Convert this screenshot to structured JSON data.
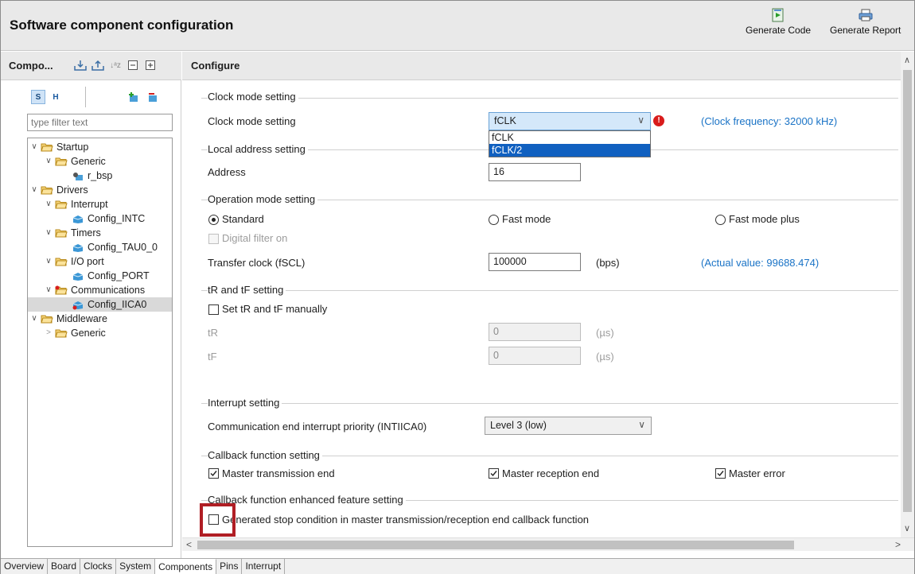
{
  "header": {
    "title": "Software component configuration",
    "generate_code": "Generate Code",
    "generate_report": "Generate Report"
  },
  "left": {
    "title": "Compo...",
    "filter_placeholder": "type filter text",
    "tree": [
      {
        "label": "Startup",
        "type": "folder",
        "expanded": true
      },
      {
        "label": "Generic",
        "type": "folder",
        "expanded": true
      },
      {
        "label": "r_bsp",
        "type": "component"
      },
      {
        "label": "Drivers",
        "type": "folder",
        "expanded": true
      },
      {
        "label": "Interrupt",
        "type": "folder",
        "expanded": true
      },
      {
        "label": "Config_INTC",
        "type": "config"
      },
      {
        "label": "Timers",
        "type": "folder",
        "expanded": true
      },
      {
        "label": "Config_TAU0_0",
        "type": "config"
      },
      {
        "label": "I/O port",
        "type": "folder",
        "expanded": true
      },
      {
        "label": "Config_PORT",
        "type": "config"
      },
      {
        "label": "Communications",
        "type": "folder",
        "expanded": true
      },
      {
        "label": "Config_IICA0",
        "type": "config",
        "selected": true
      },
      {
        "label": "Middleware",
        "type": "folder",
        "expanded": true
      },
      {
        "label": "Generic",
        "type": "folder",
        "expanded": false
      }
    ]
  },
  "main": {
    "title": "Configure",
    "clock": {
      "group": "Clock mode setting",
      "label": "Clock mode setting",
      "value": "fCLK",
      "options": [
        "fCLK",
        "fCLK/2"
      ],
      "highlighted_option": "fCLK/2",
      "freq_note": "(Clock frequency: 32000 kHz)"
    },
    "address": {
      "group": "Local address setting",
      "label": "Address",
      "value": "16"
    },
    "operation": {
      "group": "Operation mode setting",
      "standard": "Standard",
      "fast": "Fast mode",
      "fast_plus": "Fast mode plus",
      "selected": "Standard",
      "digital_filter": "Digital filter on",
      "transfer_label": "Transfer clock (fSCL)",
      "transfer_value": "100000",
      "transfer_unit": "(bps)",
      "actual_value": "(Actual value: 99688.474)"
    },
    "trtf": {
      "group": "tR and tF setting",
      "manual": "Set tR and tF manually",
      "tr_label": "tR",
      "tr_value": "0",
      "tf_label": "tF",
      "tf_value": "0",
      "unit": "(µs)"
    },
    "interrupt": {
      "group": "Interrupt setting",
      "label": "Communication end interrupt priority (INTIICA0)",
      "value": "Level 3 (low)"
    },
    "callback": {
      "group": "Callback function setting",
      "tx_end": "Master transmission end",
      "rx_end": "Master reception end",
      "error": "Master error"
    },
    "enhanced": {
      "group": "Callback function enhanced feature setting",
      "stop_condition": "Generated stop condition in master transmission/reception end callback function"
    }
  },
  "tabs": [
    "Overview",
    "Board",
    "Clocks",
    "System",
    "Components",
    "Pins",
    "Interrupt"
  ],
  "active_tab": "Components",
  "colors": {
    "accent_blue": "#1a73c6",
    "highlight_red": "#b01e24",
    "selection_blue": "#1060c0"
  }
}
